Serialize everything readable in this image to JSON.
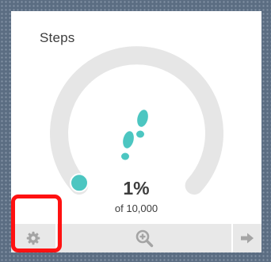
{
  "card": {
    "title": "Steps",
    "percent_text": "1%",
    "goal_text": "of 10,000",
    "progress_fraction": 0.01
  },
  "icons": {
    "center": "footprints-icon",
    "footer_left": "gear-icon",
    "footer_center": "zoom-in-icon",
    "footer_right": "arrow-right-icon"
  },
  "colors": {
    "accent": "#4cc6c1",
    "track": "#e6e6e6",
    "highlight": "#ff1111",
    "footer": "#e8e8e8"
  }
}
